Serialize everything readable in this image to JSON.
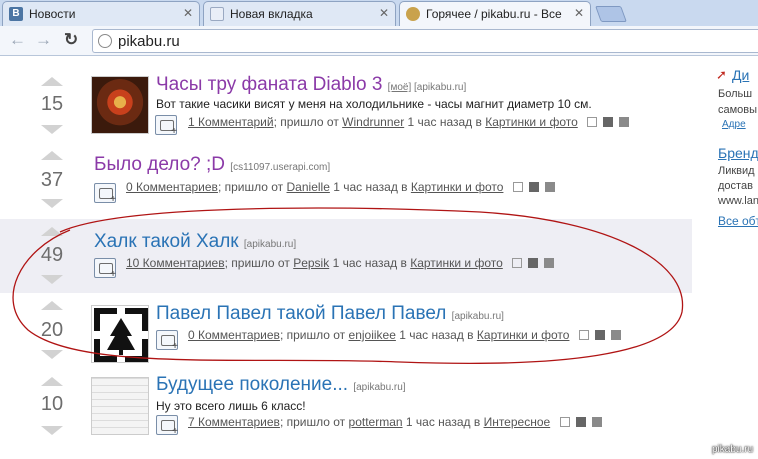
{
  "browser": {
    "tabs": [
      {
        "label": "Новости",
        "icon": "vk-icon",
        "color": "#4c75a3"
      },
      {
        "label": "Новая вкладка",
        "icon": "blank-page-icon",
        "color": "#e9eef7"
      },
      {
        "label": "Горячее / pikabu.ru - Все",
        "icon": "pikabu-icon",
        "color": "#8b6b3b"
      }
    ],
    "address": "pikabu.ru"
  },
  "posts": [
    {
      "score": "15",
      "title": "Часы тру фаната Diablo 3",
      "source_tag": "[моё]",
      "source": "[apikabu.ru]",
      "description": "Вот такие часики висят у меня на холодильнике - часы магнит диаметр 10 см.",
      "comments": "1 Комментарий",
      "came_from": "; пришло от",
      "author": "Windrunner",
      "time": "1 час назад в",
      "category": "Картинки и фото"
    },
    {
      "score": "37",
      "title": "Было дело? ;D",
      "source": "[cs11097.userapi.com]",
      "comments": "0 Комментариев",
      "came_from": "; пришло от",
      "author": "Danielle",
      "time": "1 час назад в",
      "category": "Картинки и фото"
    },
    {
      "score": "49",
      "title": "Халк такой Халк",
      "source": "[apikabu.ru]",
      "comments": "10 Комментариев",
      "came_from": "; пришло от",
      "author": "Pepsik",
      "time": "1 час назад в",
      "category": "Картинки и фото"
    },
    {
      "score": "20",
      "title": "Павел Павел такой Павел Павел",
      "source": "[apikabu.ru]",
      "comments": "0 Комментариев",
      "came_from": "; пришло от",
      "author": "enjoiikee",
      "time": "1 час назад в",
      "category": "Картинки и фото"
    },
    {
      "score": "10",
      "title": "Будущее поколение...",
      "source": "[apikabu.ru]",
      "description": "Ну это всего лишь 6 класс!",
      "comments": "7 Комментариев",
      "came_from": "; пришло от",
      "author": "potterman",
      "time": "1 час назад в",
      "category": "Интересное"
    }
  ],
  "sidebar": {
    "item1_title": "Ди",
    "item1_line1": "Больш",
    "item1_line2": "самовы",
    "item1_link": "Адре",
    "item2_title": "Бренд",
    "item2_line1": "Ликвид",
    "item2_line2": "достав",
    "item2_line3": "www.lan",
    "more_link": "Все обт"
  },
  "watermark": "pikabu.ru",
  "colors": {
    "title_purple": "#8b3aa8",
    "title_blue": "#2a73b5",
    "highlight_row": "#eeeef4",
    "ellipse_red": "#b01414"
  }
}
